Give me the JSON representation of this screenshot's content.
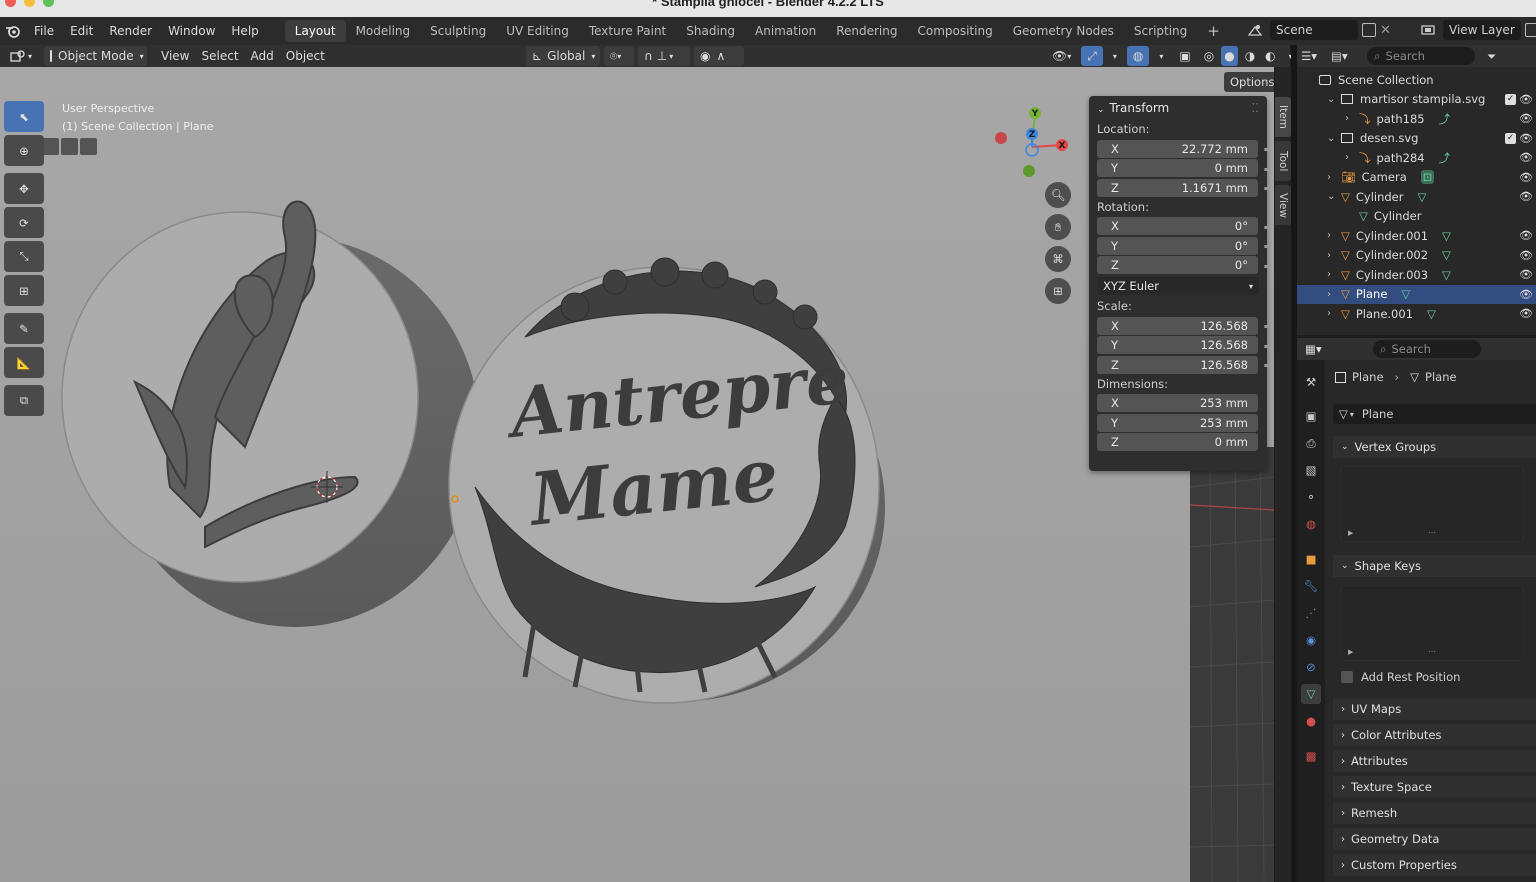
{
  "window": {
    "title": "* Stampila ghiocel - Blender 4.2.2 LTS"
  },
  "menu": {
    "items": [
      "File",
      "Edit",
      "Render",
      "Window",
      "Help"
    ]
  },
  "workspaces": {
    "tabs": [
      "Layout",
      "Modeling",
      "Sculpting",
      "UV Editing",
      "Texture Paint",
      "Shading",
      "Animation",
      "Rendering",
      "Compositing",
      "Geometry Nodes",
      "Scripting"
    ],
    "active": "Layout",
    "add": "+"
  },
  "topright": {
    "scene": "Scene",
    "view_layer": "View Layer"
  },
  "viewport_header": {
    "mode": "Object Mode",
    "menus": [
      "View",
      "Select",
      "Add",
      "Object"
    ],
    "orientation": "Global",
    "options": "Options"
  },
  "viewport": {
    "perspective": "User Perspective",
    "context": "(1) Scene Collection | Plane",
    "logo_text": [
      "Antrepre",
      "Mame"
    ]
  },
  "gizmo": {
    "x": "X",
    "y": "Y",
    "z": "Z"
  },
  "transform": {
    "title": "Transform",
    "location_label": "Location:",
    "location": [
      {
        "axis": "X",
        "value": "22.772 mm"
      },
      {
        "axis": "Y",
        "value": "0 mm"
      },
      {
        "axis": "Z",
        "value": "1.1671 mm"
      }
    ],
    "rotation_label": "Rotation:",
    "rotation": [
      {
        "axis": "X",
        "value": "0°"
      },
      {
        "axis": "Y",
        "value": "0°"
      },
      {
        "axis": "Z",
        "value": "0°"
      }
    ],
    "rotation_mode": "XYZ Euler",
    "scale_label": "Scale:",
    "scale": [
      {
        "axis": "X",
        "value": "126.568"
      },
      {
        "axis": "Y",
        "value": "126.568"
      },
      {
        "axis": "Z",
        "value": "126.568"
      }
    ],
    "dimensions_label": "Dimensions:",
    "dimensions": [
      {
        "axis": "X",
        "value": "253 mm"
      },
      {
        "axis": "Y",
        "value": "253 mm"
      },
      {
        "axis": "Z",
        "value": "0 mm"
      }
    ]
  },
  "sidetabs": [
    "Item",
    "Tool",
    "View"
  ],
  "outliner": {
    "search_placeholder": "Search",
    "root": "Scene Collection",
    "items": [
      {
        "label": "martisor stampila.svg",
        "indent": 1,
        "type": "collection",
        "expanded": true,
        "check": true
      },
      {
        "label": "path185",
        "indent": 2,
        "type": "curve",
        "expanded": false
      },
      {
        "label": "desen.svg",
        "indent": 1,
        "type": "collection",
        "expanded": true,
        "check": true
      },
      {
        "label": "path284",
        "indent": 2,
        "type": "curve",
        "expanded": false
      },
      {
        "label": "Camera",
        "indent": 1,
        "type": "camera",
        "expanded": false
      },
      {
        "label": "Cylinder",
        "indent": 1,
        "type": "mesh",
        "expanded": true
      },
      {
        "label": "Cylinder",
        "indent": 2,
        "type": "meshdata",
        "expanded": null
      },
      {
        "label": "Cylinder.001",
        "indent": 1,
        "type": "mesh",
        "expanded": false
      },
      {
        "label": "Cylinder.002",
        "indent": 1,
        "type": "mesh",
        "expanded": false
      },
      {
        "label": "Cylinder.003",
        "indent": 1,
        "type": "mesh",
        "expanded": false
      },
      {
        "label": "Plane",
        "indent": 1,
        "type": "mesh",
        "expanded": false,
        "selected": true
      },
      {
        "label": "Plane.001",
        "indent": 1,
        "type": "mesh",
        "expanded": false
      }
    ]
  },
  "properties": {
    "search_placeholder": "Search",
    "breadcrumb": [
      "Plane",
      "Plane"
    ],
    "datablock": "Plane",
    "vertex_groups": "Vertex Groups",
    "shape_keys": "Shape Keys",
    "add_rest_position": "Add Rest Position",
    "collapsed_panels": [
      "UV Maps",
      "Color Attributes",
      "Attributes",
      "Texture Space",
      "Remesh",
      "Geometry Data",
      "Custom Properties"
    ]
  },
  "colors": {
    "accent": "#4772b3",
    "selected_row": "#334d80",
    "mesh_icon": "#e89b3f",
    "data_icon": "#6dcf9c",
    "axis_x": "#e04848",
    "axis_y": "#74b533",
    "axis_z": "#3f86de"
  }
}
